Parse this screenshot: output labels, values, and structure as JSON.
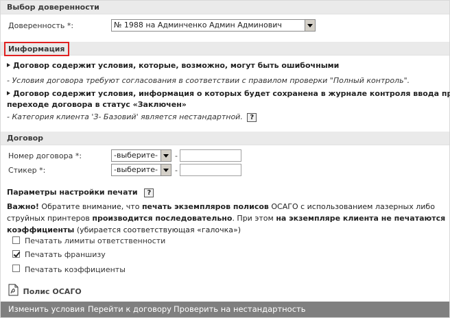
{
  "proxy_section": {
    "title": "Выбор доверенности",
    "proxy_label": "Доверенность *:",
    "proxy_value": "№ 1988 на Админченко Админ Админович"
  },
  "info_section": {
    "title": "Информация",
    "item1": "Договор содержит условия, которые, возможно, могут быть ошибочными",
    "note1": "- Условия договора требуют согласования в соответствии с правилом проверки \"Полный контроль\".",
    "item2_line1": "Договор содержит условия, информация о которых будет сохранена в журнале контроля ввода при",
    "item2_line2": "переходе договора в статус «Заключен»",
    "note2": "- Категория клиента 'З- Базовий' является нестандартной.",
    "help": "?"
  },
  "contract_section": {
    "title": "Договор",
    "number_label": "Номер договора *:",
    "number_select": "-выберите-",
    "sticker_label": "Стикер *:",
    "sticker_select": "-выберите-",
    "dash": "-"
  },
  "print_section": {
    "title": "Параметры настройки печати",
    "help": "?",
    "warn_strong": "Важно!",
    "warn_t1": " Обратите внимание, что ",
    "warn_b1": "печать экземпляров полисов",
    "warn_t2": " ОСАГО с использованием лазерных либо",
    "warn_t3": "струйных принтеров ",
    "warn_b2": "производится последовательно",
    "warn_t4": ". При этом ",
    "warn_b3": "на экземпляре клиента не печатаются",
    "warn_b4": "коэффициенты",
    "warn_t5": " (убирается соответствующая «галочка»)",
    "options": [
      {
        "label": "Печатать лимиты ответственности",
        "checked": false
      },
      {
        "label": "Печатать франшизу",
        "checked": true
      },
      {
        "label": "Печатать коэффициенты",
        "checked": false
      }
    ],
    "policy_link": "Полис ОСАГО"
  },
  "bottom_bar": {
    "change_terms": "Изменить условия",
    "go_to_contract": "Перейти к договору",
    "check_nonstandard": "Проверить на нестандартность"
  },
  "colors": {
    "header_bg": "#eaeaea",
    "bar_bg": "#7f7f7f",
    "highlight_border": "#e02020"
  }
}
